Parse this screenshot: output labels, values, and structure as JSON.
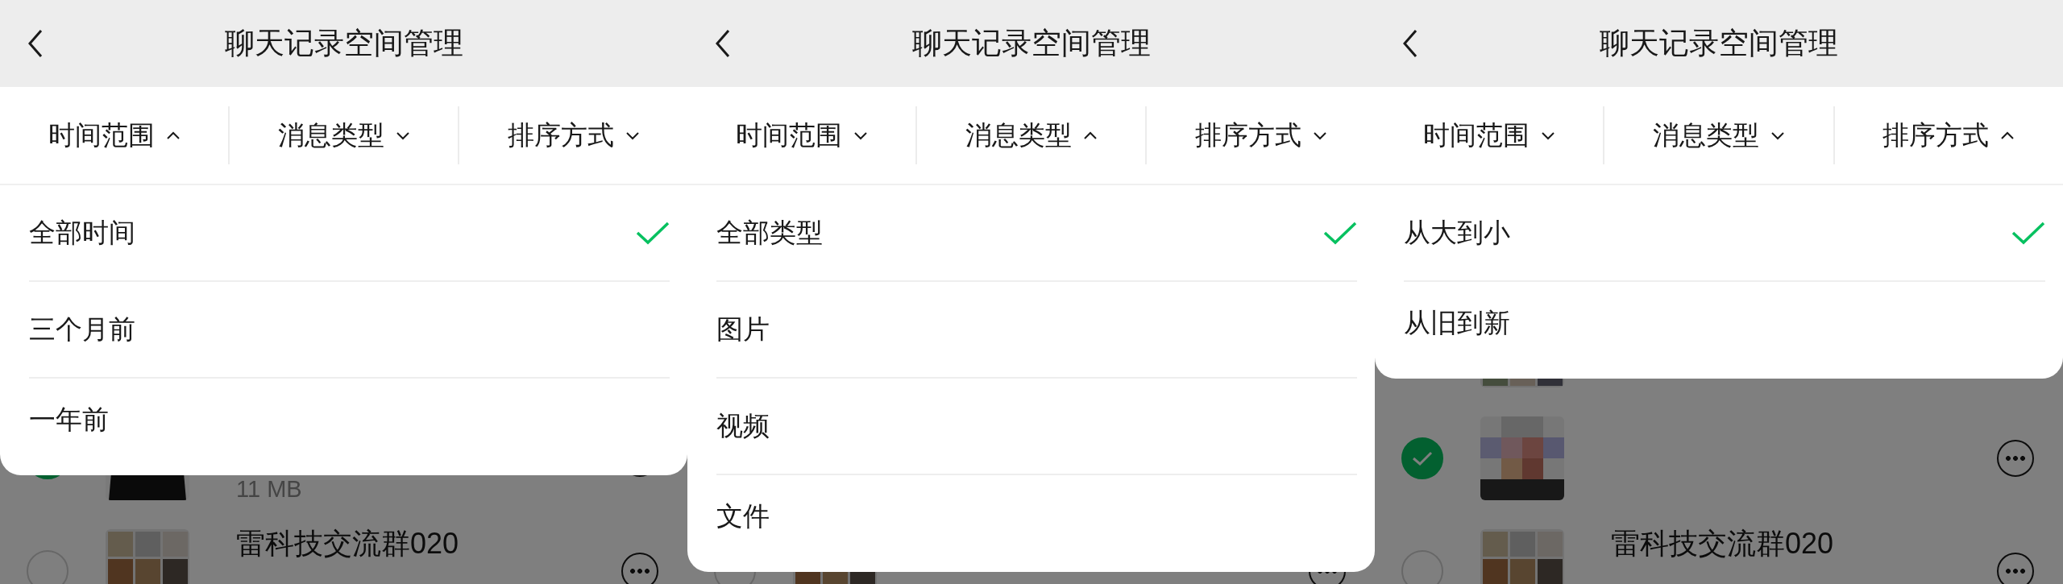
{
  "panels": [
    {
      "title": "聊天记录空间管理",
      "filters": [
        {
          "label": "时间范围",
          "expanded": true
        },
        {
          "label": "消息类型",
          "expanded": false
        },
        {
          "label": "排序方式",
          "expanded": false
        }
      ],
      "options": [
        {
          "label": "全部时间",
          "selected": true
        },
        {
          "label": "三个月前",
          "selected": false
        },
        {
          "label": "一年前",
          "selected": false
        }
      ],
      "rows": [
        {
          "checked": true,
          "size": "11 MB"
        },
        {
          "checked": false,
          "name": "雷科技交流群020"
        }
      ]
    },
    {
      "title": "聊天记录空间管理",
      "filters": [
        {
          "label": "时间范围",
          "expanded": false
        },
        {
          "label": "消息类型",
          "expanded": true
        },
        {
          "label": "排序方式",
          "expanded": false
        }
      ],
      "options": [
        {
          "label": "全部类型",
          "selected": true
        },
        {
          "label": "图片",
          "selected": false
        },
        {
          "label": "视频",
          "selected": false
        },
        {
          "label": "文件",
          "selected": false
        }
      ],
      "rows": [
        {
          "checked": false
        }
      ]
    },
    {
      "title": "聊天记录空间管理",
      "filters": [
        {
          "label": "时间范围",
          "expanded": false
        },
        {
          "label": "消息类型",
          "expanded": false
        },
        {
          "label": "排序方式",
          "expanded": true
        }
      ],
      "options": [
        {
          "label": "从大到小",
          "selected": true
        },
        {
          "label": "从旧到新",
          "selected": false
        }
      ],
      "rows": [
        {},
        {
          "checked": true
        },
        {
          "checked": false,
          "name": "雷科技交流群020"
        }
      ]
    }
  ]
}
